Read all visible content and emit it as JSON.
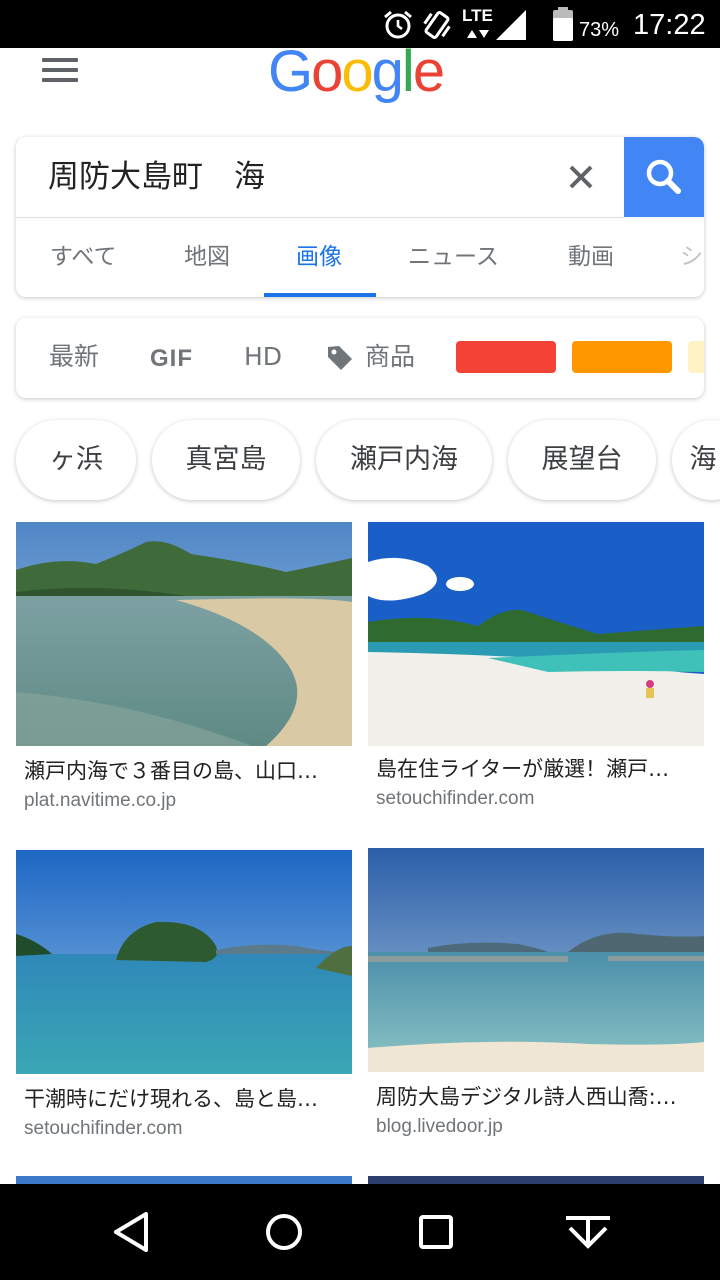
{
  "status_bar": {
    "battery_percent": "73%",
    "time": "17:22",
    "network": "LTE",
    "icons": [
      "alarm-icon",
      "vibrate-icon",
      "signal-icon",
      "battery-icon"
    ]
  },
  "header": {
    "logo": "Google",
    "logo_colors": [
      "#4285F4",
      "#EA4335",
      "#FBBC05",
      "#4285F4",
      "#34A853",
      "#EA4335"
    ]
  },
  "search": {
    "query": "周防大島町　海",
    "accent": "#4285f4"
  },
  "tabs": [
    {
      "label": "すべて",
      "active": false
    },
    {
      "label": "地図",
      "active": false
    },
    {
      "label": "画像",
      "active": true
    },
    {
      "label": "ニュース",
      "active": false
    },
    {
      "label": "動画",
      "active": false
    },
    {
      "label": "シ",
      "active": false
    }
  ],
  "tools": {
    "latest": "最新",
    "gif": "GIF",
    "hd": "HD",
    "products": "商品",
    "color_swatches": [
      "#f44336",
      "#ff9800",
      "#fff3c4"
    ]
  },
  "chips": [
    "ヶ浜",
    "真宮島",
    "瀬戸内海",
    "展望台",
    "海"
  ],
  "results": [
    {
      "title": "瀬戸内海で３番目の島、山口…",
      "source": "plat.navitime.co.jp"
    },
    {
      "title": "島在住ライターが厳選！瀬戸…",
      "source": "setouchifinder.com"
    },
    {
      "title": "干潮時にだけ現れる、島と島…",
      "source": "setouchifinder.com"
    },
    {
      "title": "周防大島デジタル詩人西山喬:…",
      "source": "blog.livedoor.jp"
    }
  ],
  "nav": {
    "icons": [
      "back-icon",
      "home-icon",
      "recents-icon",
      "keyboard-hide-icon"
    ]
  }
}
